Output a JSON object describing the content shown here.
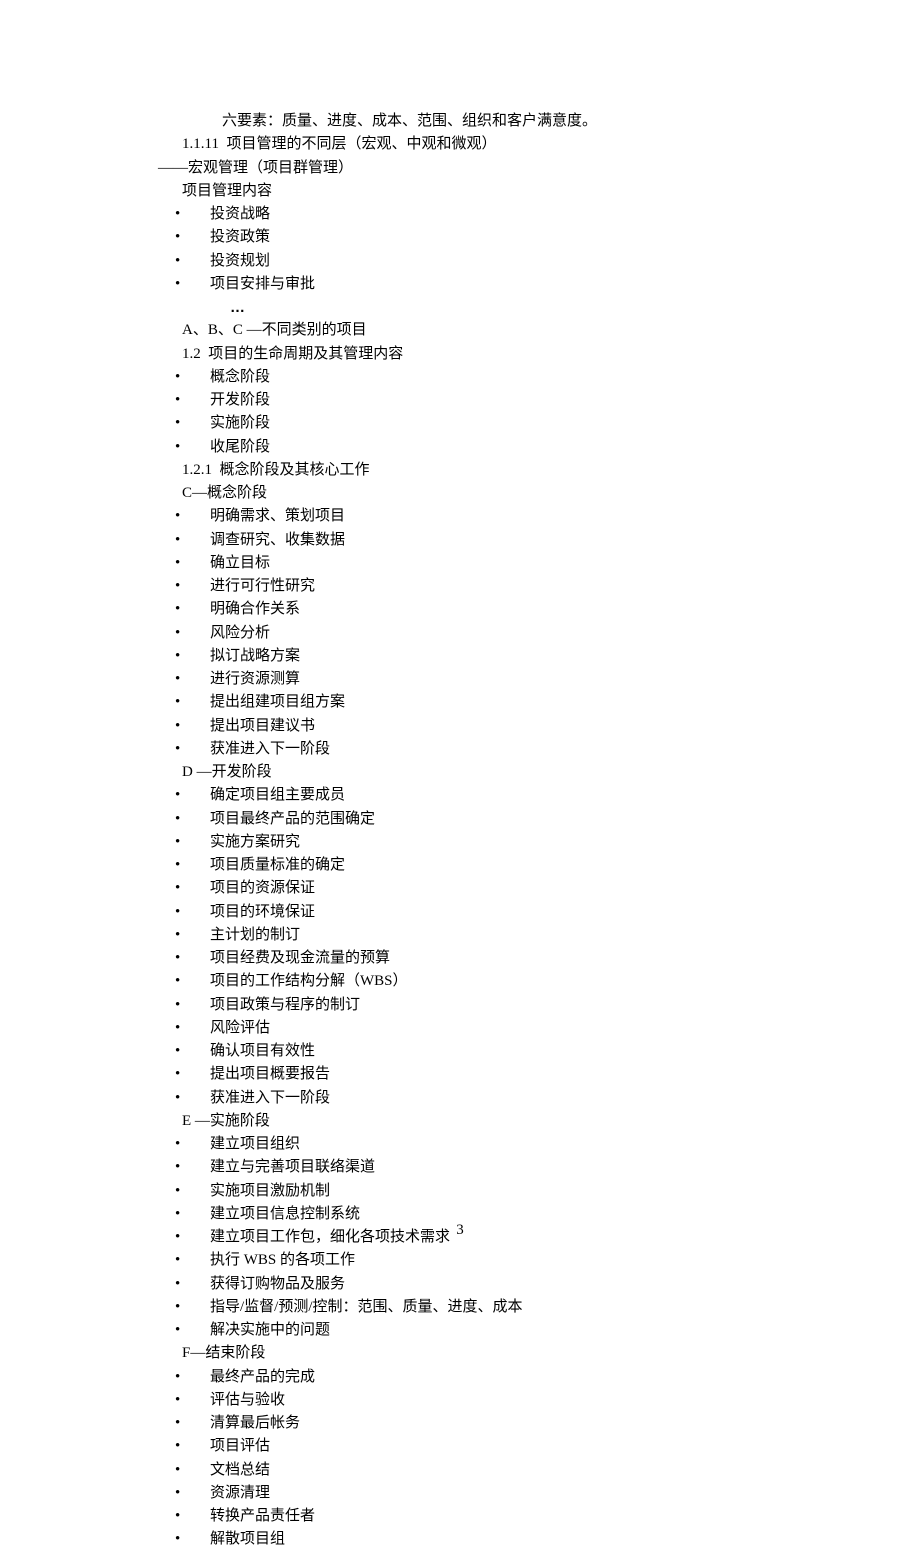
{
  "intro": {
    "sixElements": "六要素：质量、进度、成本、范围、组织和客户满意度。",
    "section_1_1_11": "1.1.11  项目管理的不同层（宏观、中观和微观）",
    "macroLine": "——宏观管理（项目群管理）",
    "pmContentLabel": "项目管理内容"
  },
  "pmContent": {
    "items": [
      "投资战略",
      "投资政策",
      "投资规划",
      "项目安排与审批"
    ],
    "ellipsis": "…",
    "abcLine": "A、B、C —不同类别的项目"
  },
  "section_1_2": {
    "title": "1.2  项目的生命周期及其管理内容",
    "phases": [
      "概念阶段",
      "开发阶段",
      "实施阶段",
      "收尾阶段"
    ]
  },
  "section_1_2_1": {
    "title": "1.2.1  概念阶段及其核心工作",
    "cLabel": "C—概念阶段",
    "cItems": [
      "明确需求、策划项目",
      "调查研究、收集数据",
      "确立目标",
      "进行可行性研究",
      "明确合作关系",
      "风险分析",
      "拟订战略方案",
      "进行资源测算",
      "提出组建项目组方案",
      "提出项目建议书",
      "获准进入下一阶段"
    ],
    "dLabel": "D —开发阶段",
    "dItems": [
      "确定项目组主要成员",
      "项目最终产品的范围确定",
      "实施方案研究",
      "项目质量标准的确定",
      "项目的资源保证",
      "项目的环境保证",
      "主计划的制订",
      "项目经费及现金流量的预算",
      "项目的工作结构分解（WBS）",
      "项目政策与程序的制订",
      "风险评估",
      "确认项目有效性",
      "提出项目概要报告",
      "获准进入下一阶段"
    ],
    "eLabel": "E —实施阶段",
    "eItems": [
      "建立项目组织",
      "建立与完善项目联络渠道",
      "实施项目激励机制",
      "建立项目信息控制系统",
      "建立项目工作包，细化各项技术需求",
      "执行 WBS 的各项工作",
      "获得订购物品及服务",
      "指导/监督/预测/控制：范围、质量、进度、成本",
      "解决实施中的问题"
    ],
    "fLabel": "F—结束阶段",
    "fItems": [
      "最终产品的完成",
      "评估与验收",
      "清算最后帐务",
      "项目评估",
      "文档总结",
      "资源清理",
      "转换产品责任者",
      "解散项目组"
    ]
  },
  "pageNumber": "3"
}
